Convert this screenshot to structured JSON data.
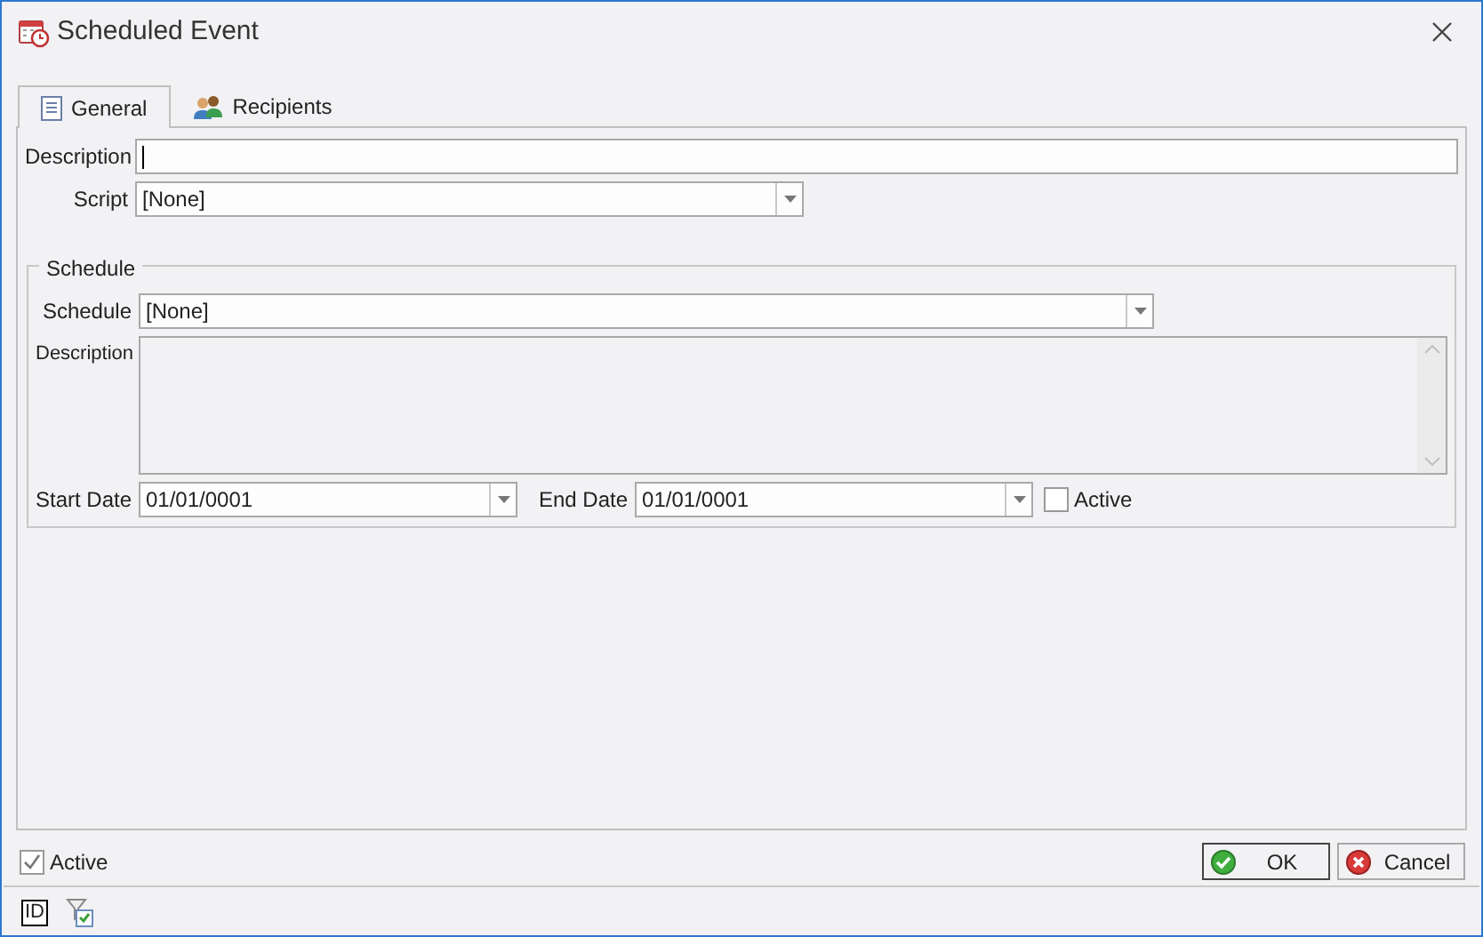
{
  "window": {
    "title": "Scheduled Event"
  },
  "tabs": [
    {
      "label": "General",
      "selected": true
    },
    {
      "label": "Recipients",
      "selected": false
    }
  ],
  "general": {
    "description": {
      "label": "Description"
    },
    "script": {
      "label": "Script",
      "value": "[None]"
    }
  },
  "schedule_group": {
    "title": "Schedule",
    "schedule": {
      "label": "Schedule",
      "value": "[None]"
    },
    "description": {
      "label": "Description"
    },
    "start_date": {
      "label": "Start Date",
      "value": "01/01/0001"
    },
    "end_date": {
      "label": "End Date",
      "value": "01/01/0001"
    },
    "active": {
      "label": "Active",
      "checked": false
    }
  },
  "footer": {
    "active": {
      "label": "Active",
      "checked": true
    },
    "buttons": [
      {
        "label": "OK",
        "kind": "ok",
        "default": true
      },
      {
        "label": "Cancel",
        "kind": "cancel",
        "default": false
      }
    ]
  },
  "status_bar": {
    "id_badge": "ID"
  }
}
